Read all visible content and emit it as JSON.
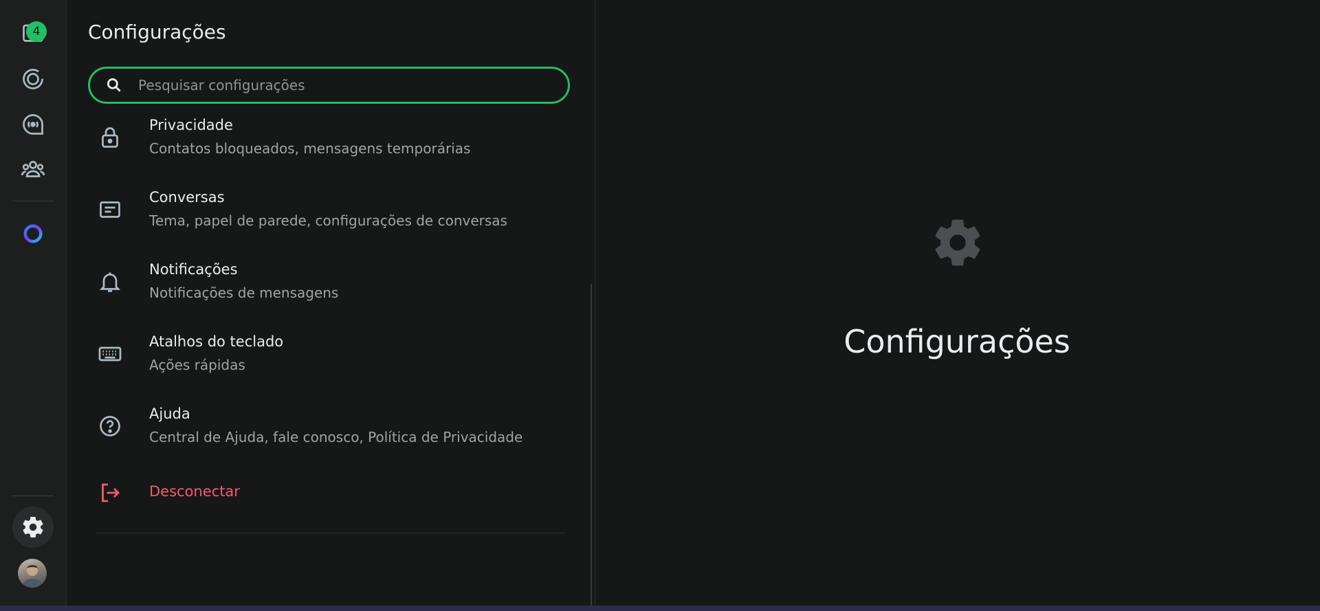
{
  "rail": {
    "chats_badge": "4",
    "icons": [
      "chats-icon",
      "status-icon",
      "channels-icon",
      "communities-icon",
      "meta-ai-icon",
      "settings-icon"
    ]
  },
  "settings": {
    "title": "Configurações",
    "search": {
      "placeholder": "Pesquisar configurações",
      "value": ""
    },
    "items": [
      {
        "title": "Privacidade",
        "subtitle": "Contatos bloqueados, mensagens temporárias",
        "icon": "lock-icon"
      },
      {
        "title": "Conversas",
        "subtitle": "Tema, papel de parede, configurações de conversas",
        "icon": "chat-icon"
      },
      {
        "title": "Notificações",
        "subtitle": "Notificações de mensagens",
        "icon": "bell-icon"
      },
      {
        "title": "Atalhos do teclado",
        "subtitle": "Ações rápidas",
        "icon": "keyboard-icon"
      },
      {
        "title": "Ajuda",
        "subtitle": "Central de Ajuda, fale conosco, Política de Privacidade",
        "icon": "help-icon"
      }
    ],
    "logout": {
      "label": "Desconectar",
      "icon": "logout-icon"
    }
  },
  "main": {
    "title": "Configurações",
    "icon": "gear-icon"
  },
  "colors": {
    "accent": "#21c063",
    "danger": "#f15c6d",
    "background": "#161717",
    "rail": "#1d1f1f"
  }
}
